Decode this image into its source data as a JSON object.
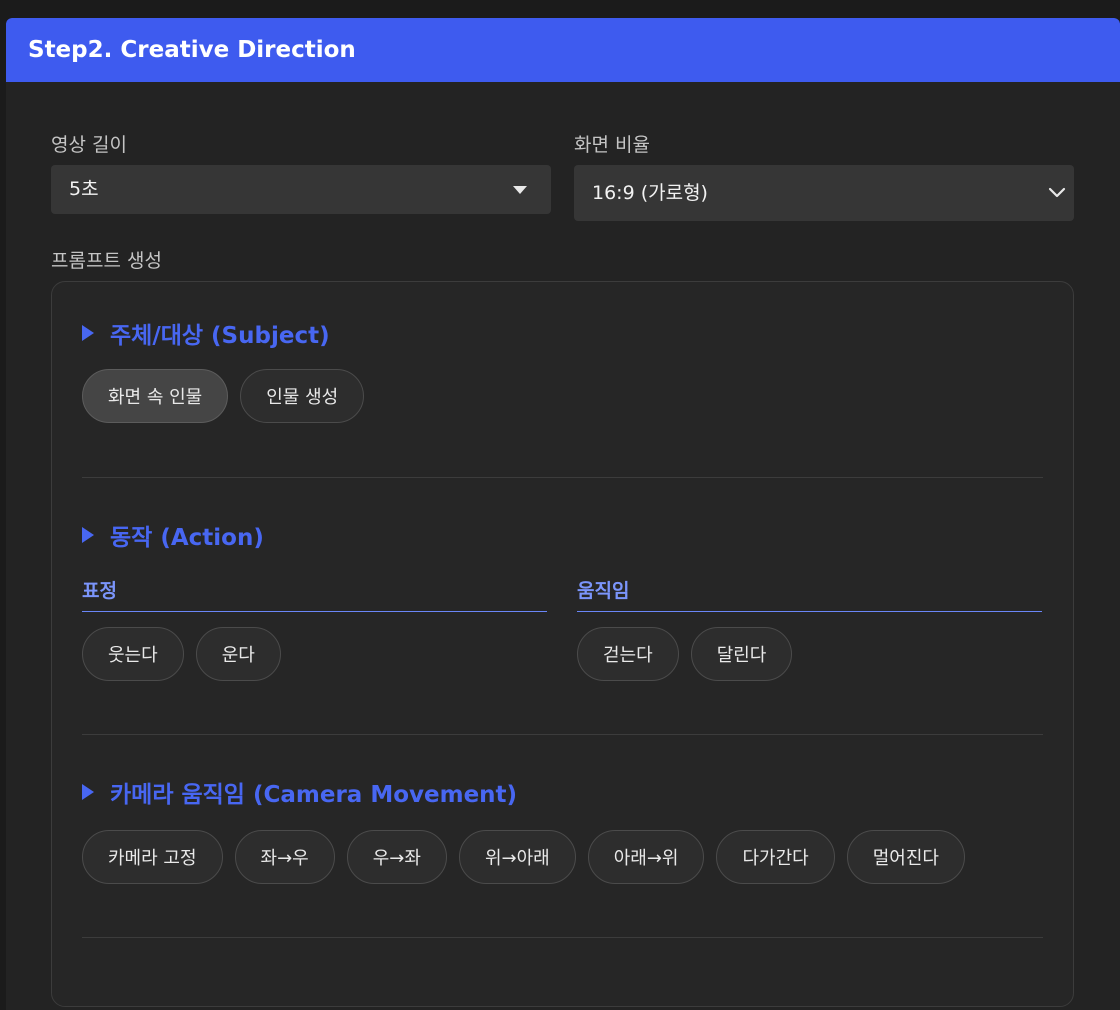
{
  "header": {
    "title": "Step2. Creative Direction"
  },
  "duration": {
    "label": "영상 길이",
    "value": "5초"
  },
  "aspect_ratio": {
    "label": "화면 비율",
    "value": "16:9 (가로형)"
  },
  "prompt": {
    "label": "프롬프트 생성",
    "subject": {
      "title": "주체/대상 (Subject)",
      "options": [
        "화면 속 인물",
        "인물 생성"
      ],
      "selected": "화면 속 인물"
    },
    "action": {
      "title": "동작 (Action)",
      "expression": {
        "label": "표정",
        "options": [
          "웃는다",
          "운다"
        ]
      },
      "movement": {
        "label": "움직임",
        "options": [
          "걷는다",
          "달린다"
        ]
      }
    },
    "camera": {
      "title": "카메라 움직임 (Camera Movement)",
      "options": [
        "카메라 고정",
        "좌→우",
        "우→좌",
        "위→아래",
        "아래→위",
        "다가간다",
        "멀어진다"
      ]
    }
  },
  "colors": {
    "header_bg": "#3e5bef",
    "accent": "#4867f2",
    "sub_accent": "#7b95fb"
  }
}
